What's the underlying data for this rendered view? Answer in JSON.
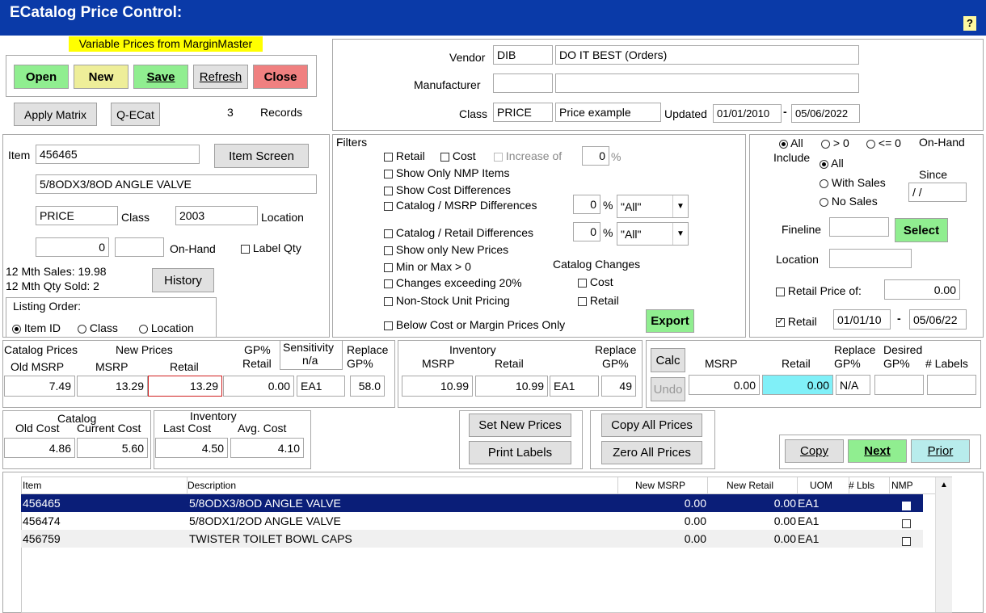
{
  "window": {
    "title": "ECatalog Price Control:",
    "help": "?"
  },
  "banner": "Variable Prices from MarginMaster",
  "toolbar": {
    "open": "Open",
    "new": "New",
    "save": "Save",
    "refresh": "Refresh",
    "close": "Close",
    "apply_matrix": "Apply Matrix",
    "qecat": "Q-ECat",
    "record_count": "3",
    "records_label": "Records"
  },
  "vendor": {
    "vendor_label": "Vendor",
    "vendor_code": "DIB",
    "vendor_name": "DO IT BEST (Orders)",
    "manufacturer_label": "Manufacturer",
    "manufacturer_code": "",
    "manufacturer_name": "",
    "class_label": "Class",
    "class_code": "PRICE",
    "class_name": "Price example",
    "updated_label": "Updated",
    "updated_from": "01/01/2010",
    "updated_to": "05/06/2022",
    "dash": "-"
  },
  "item": {
    "item_label": "Item",
    "item_no": "456465",
    "item_screen": "Item Screen",
    "description": "5/8ODX3/8OD ANGLE VALVE",
    "class": "PRICE",
    "class_label": "Class",
    "location": "2003",
    "location_label": "Location",
    "onhand_qty": "0",
    "onhand_extra": "",
    "onhand_label": "On-Hand",
    "label_qty_label": "Label Qty",
    "sales_12": "12 Mth Sales: 19.98",
    "qty_12": "12 Mth Qty Sold: 2",
    "history": "History",
    "listing_order_label": "Listing Order:",
    "order_item": "Item ID",
    "order_class": "Class",
    "order_location": "Location"
  },
  "filters": {
    "title": "Filters",
    "retail": "Retail",
    "cost": "Cost",
    "increase_of": "Increase of",
    "increase_val": "0",
    "pct": "%",
    "nmp": "Show Only NMP Items",
    "cost_diff": "Show Cost Differences",
    "cat_msrp": "Catalog / MSRP Differences",
    "cat_msrp_val": "0",
    "cat_msrp_sel": "\"All\"",
    "cat_retail": "Catalog / Retail Differences",
    "cat_retail_val": "0",
    "cat_retail_sel": "\"All\"",
    "new_prices": "Show only New Prices",
    "minmax": "Min or Max > 0",
    "changes20": "Changes exceeding 20%",
    "nonstock": "Non-Stock Unit Pricing",
    "below_cost": "Below Cost or Margin Prices Only",
    "catalog_changes": "Catalog Changes",
    "cc_cost": "Cost",
    "cc_retail": "Retail",
    "export": "Export"
  },
  "include": {
    "all_top": "All",
    "gt0": "> 0",
    "le0": "<= 0",
    "onhand": "On-Hand",
    "include_label": "Include",
    "all": "All",
    "with_sales": "With Sales",
    "no_sales": "No Sales",
    "since_label": "Since",
    "since_val": " /  /",
    "fineline_label": "Fineline",
    "fineline_val": "",
    "select": "Select",
    "location_label": "Location",
    "location_val": "",
    "retail_price_of": "Retail Price of:",
    "retail_price_val": "0.00",
    "retail_label": "Retail",
    "retail_from": "01/01/10",
    "retail_to": "05/06/22",
    "dash": "-"
  },
  "catalog_prices": {
    "h1": "Catalog Prices",
    "h2": "New Prices",
    "h3a": "GP%",
    "h3b": "Retail",
    "sens_a": "Sensitivity",
    "sens_b": "n/a",
    "rep_a": "Replace",
    "rep_b": "GP%",
    "old_msrp": "Old MSRP",
    "msrp": "MSRP",
    "retail": "Retail",
    "v_old_msrp": "7.49",
    "v_msrp": "13.29",
    "v_retail": "13.29",
    "v_gp": "0.00",
    "v_uom": "EA1",
    "v_rep": "58.0"
  },
  "inventory_prices": {
    "h1": "Inventory",
    "msrp": "MSRP",
    "retail": "Retail",
    "rep_a": "Replace",
    "rep_b": "GP%",
    "v_msrp": "10.99",
    "v_retail": "10.99",
    "v_uom": "EA1",
    "v_rep": "49"
  },
  "calc": {
    "calc": "Calc",
    "undo": "Undo",
    "msrp": "MSRP",
    "retail": "Retail",
    "rep_a": "Replace",
    "rep_b": "GP%",
    "des_a": "Desired",
    "des_b": "GP%",
    "labels": "# Labels",
    "v_msrp": "0.00",
    "v_retail": "0.00",
    "v_rep": "N/A",
    "v_des": "",
    "v_labels": ""
  },
  "cost": {
    "h1": "Catalog",
    "old_cost": "Old Cost",
    "current_cost": "Current Cost",
    "v_old": "4.86",
    "v_current": "5.60",
    "inv_h": "Inventory",
    "last_cost": "Last Cost",
    "avg_cost": "Avg. Cost",
    "v_last": "4.50",
    "v_avg": "4.10"
  },
  "actions": {
    "set_new": "Set New Prices",
    "print_labels": "Print Labels",
    "copy_all": "Copy All Prices",
    "zero_all": "Zero All Prices",
    "copy": "Copy",
    "next": "Next",
    "prior": "Prior"
  },
  "table": {
    "headers": {
      "item": "Item",
      "description": "Description",
      "new_msrp": "New MSRP",
      "new_retail": "New Retail",
      "uom": "UOM",
      "lbls": "# Lbls",
      "nmp": "NMP"
    },
    "rows": [
      {
        "item": "456465",
        "description": "5/8ODX3/8OD ANGLE VALVE",
        "new_msrp": "0.00",
        "new_retail": "0.00",
        "uom": "EA1",
        "lbls": ""
      },
      {
        "item": "456474",
        "description": "5/8ODX1/2OD ANGLE VALVE",
        "new_msrp": "0.00",
        "new_retail": "0.00",
        "uom": "EA1",
        "lbls": ""
      },
      {
        "item": "456759",
        "description": "TWISTER TOILET BOWL CAPS",
        "new_msrp": "0.00",
        "new_retail": "0.00",
        "uom": "EA1",
        "lbls": ""
      }
    ]
  },
  "colors": {
    "titlebar": "#0a3aa8",
    "selected_row": "#0a1e78",
    "banner": "#ffff00",
    "highlight_field": "#80f0f8"
  }
}
